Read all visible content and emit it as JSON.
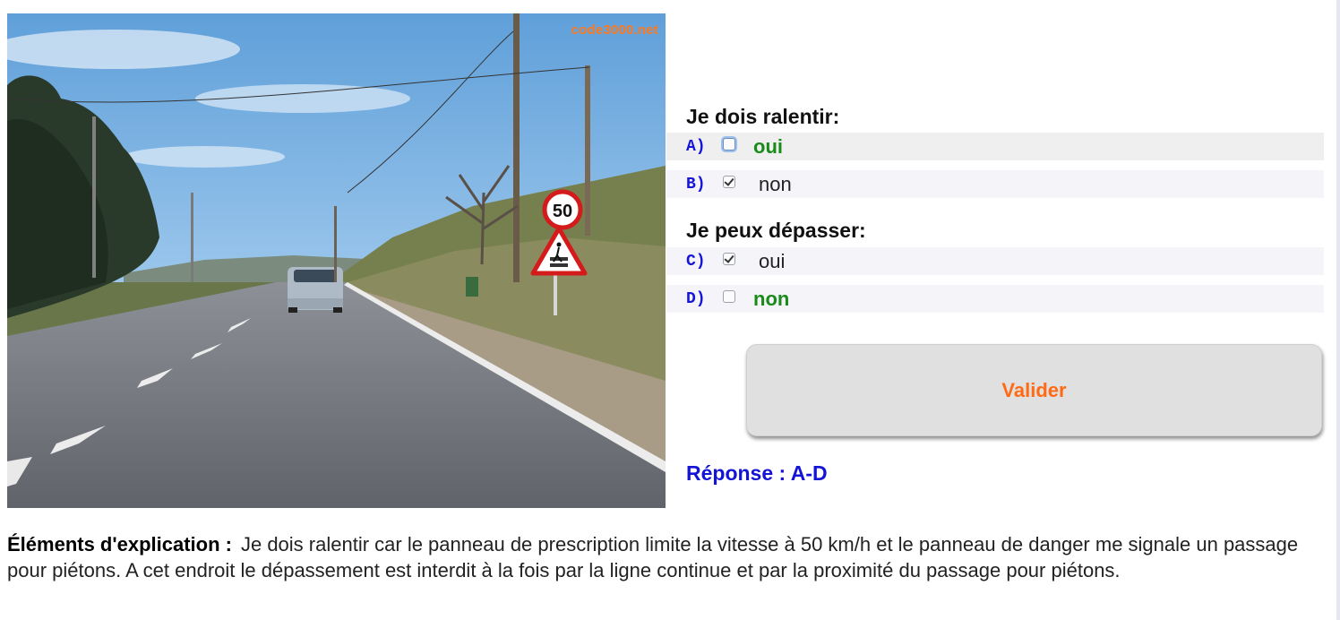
{
  "image": {
    "watermark": "code3000.net",
    "sign_speed_limit": "50"
  },
  "questions": [
    {
      "title": "Je dois ralentir:",
      "options": [
        {
          "letter": "A)",
          "text": "oui",
          "checked": false,
          "correct": true
        },
        {
          "letter": "B)",
          "text": "non",
          "checked": true,
          "correct": false
        }
      ]
    },
    {
      "title": "Je peux dépasser:",
      "options": [
        {
          "letter": "C)",
          "text": "oui",
          "checked": true,
          "correct": false
        },
        {
          "letter": "D)",
          "text": "non",
          "checked": false,
          "correct": true
        }
      ]
    }
  ],
  "validate_label": "Valider",
  "answer_text": "Réponse : A-D",
  "explanation": {
    "label": "Éléments d'explication :",
    "text": "Je dois ralentir car le panneau de prescription limite la vitesse à 50 km/h et le panneau de danger me signale un passage pour piétons. A cet endroit le dépassement est interdit à la fois par la ligne continue et par la proximité du passage pour piétons."
  },
  "colors": {
    "letter": "#1515d8",
    "correct": "#1a8b1a",
    "button_text": "#ff6a14",
    "answer": "#1414d6",
    "watermark": "#ff7a1e"
  }
}
